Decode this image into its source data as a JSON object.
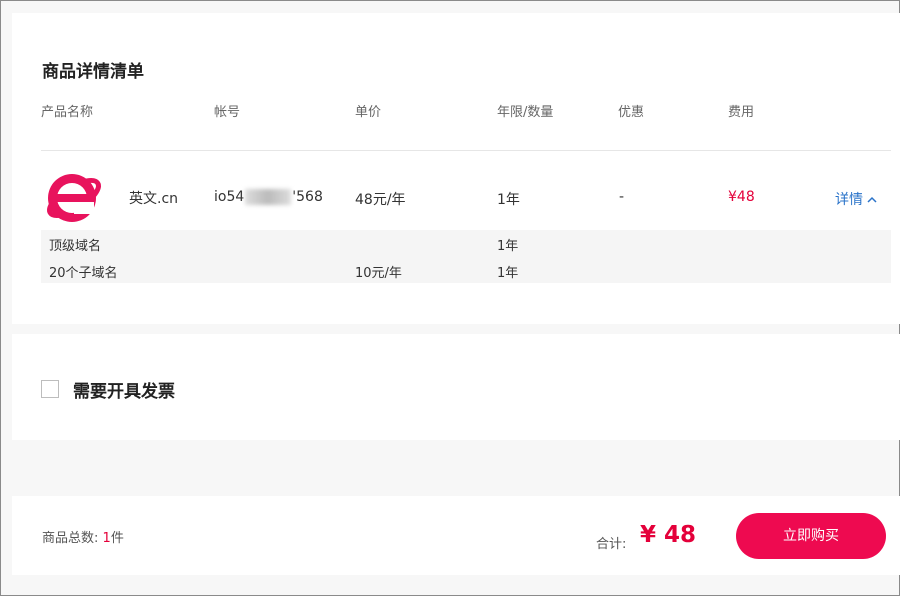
{
  "details": {
    "title": "商品详情清单",
    "headers": [
      "产品名称",
      "帐号",
      "单价",
      "年限/数量",
      "优惠",
      "费用"
    ],
    "item": {
      "product_name": "英文.cn",
      "account_prefix": "io54",
      "account_suffix": "'568",
      "unit_price": "48元/年",
      "term": "1年",
      "discount": "-",
      "fee": "¥48",
      "details_link": "详情"
    },
    "sub_items": [
      {
        "name": "顶级域名",
        "unit_price": "",
        "term": "1年"
      },
      {
        "name": "20个子域名",
        "unit_price": "10元/年",
        "term": "1年"
      }
    ]
  },
  "invoice": {
    "label": "需要开具发票",
    "checked": false
  },
  "footer": {
    "count_label": "商品总数:",
    "count_value": "1",
    "count_unit": "件",
    "total_label": "合计:",
    "total_value": "¥ 48",
    "buy_button": "立即购买"
  },
  "colors": {
    "accent": "#e4003a",
    "button": "#ee0a50",
    "link": "#2a73c9",
    "logo": "#e8135d"
  },
  "icons": {
    "product_logo": "ie-browser-logo-icon",
    "details_chevron": "chevron-up-icon"
  }
}
